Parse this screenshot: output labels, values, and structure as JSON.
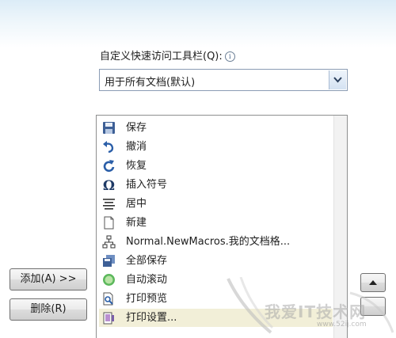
{
  "qat": {
    "label": "自定义快速访问工具栏(Q):",
    "combo_value": "用于所有文档(默认)"
  },
  "commands": [
    {
      "label": "保存",
      "icon": "save-icon"
    },
    {
      "label": "撤消",
      "icon": "undo-icon",
      "submenu": true
    },
    {
      "label": "恢复",
      "icon": "redo-icon"
    },
    {
      "label": "插入符号",
      "icon": "omega-icon",
      "submenu": true
    },
    {
      "label": "居中",
      "icon": "align-center-icon"
    },
    {
      "label": "新建",
      "icon": "new-document-icon"
    },
    {
      "label": "Normal.NewMacros.我的文档格...",
      "icon": "macro-icon"
    },
    {
      "label": "全部保存",
      "icon": "save-all-icon"
    },
    {
      "label": "自动滚动",
      "icon": "auto-scroll-icon"
    },
    {
      "label": "打印预览",
      "icon": "print-preview-icon"
    },
    {
      "label": "打印设置...",
      "icon": "print-setup-icon",
      "selected": true
    }
  ],
  "buttons": {
    "add": "添加(A) >>",
    "remove": "删除(R)"
  },
  "watermark": {
    "text": "我爱IT技术网",
    "url": "www.52ij.com"
  },
  "colors": {
    "selection": "#f2efd8",
    "accent": "#2a5ea8"
  }
}
